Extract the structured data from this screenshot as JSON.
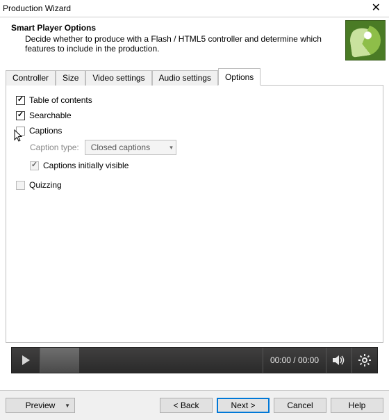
{
  "window_title": "Production Wizard",
  "header": {
    "heading": "Smart Player Options",
    "sub": "Decide whether to produce with a Flash / HTML5 controller and determine which features to include in the production."
  },
  "tabs": {
    "controller": "Controller",
    "size": "Size",
    "video": "Video settings",
    "audio": "Audio settings",
    "options": "Options"
  },
  "options": {
    "table_of_contents": "Table of contents",
    "searchable": "Searchable",
    "captions": "Captions",
    "caption_type_label": "Caption type:",
    "caption_type_value": "Closed captions",
    "captions_initially_visible": "Captions initially visible",
    "quizzing": "Quizzing"
  },
  "player": {
    "time": "00:00 / 00:00"
  },
  "footer": {
    "preview": "Preview",
    "back": "< Back",
    "next": "Next >",
    "cancel": "Cancel",
    "help": "Help"
  }
}
